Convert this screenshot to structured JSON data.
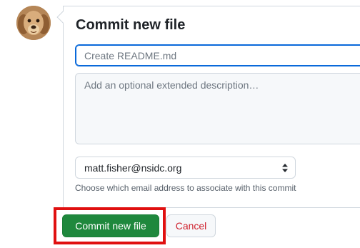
{
  "header": {
    "title": "Commit new file"
  },
  "form": {
    "summary_placeholder": "Create README.md",
    "description_placeholder": "Add an optional extended description…",
    "email_selected": "matt.fisher@nsidc.org",
    "email_hint": "Choose which email address to associate with this commit"
  },
  "actions": {
    "commit_label": "Commit new file",
    "cancel_label": "Cancel"
  },
  "icons": {
    "avatar": "dog-avatar",
    "select": "select-arrows-icon"
  },
  "colors": {
    "primary_button": "#1f883d",
    "cancel_text": "#cf222e",
    "focus_border": "#0969da",
    "highlight": "#e01010"
  }
}
